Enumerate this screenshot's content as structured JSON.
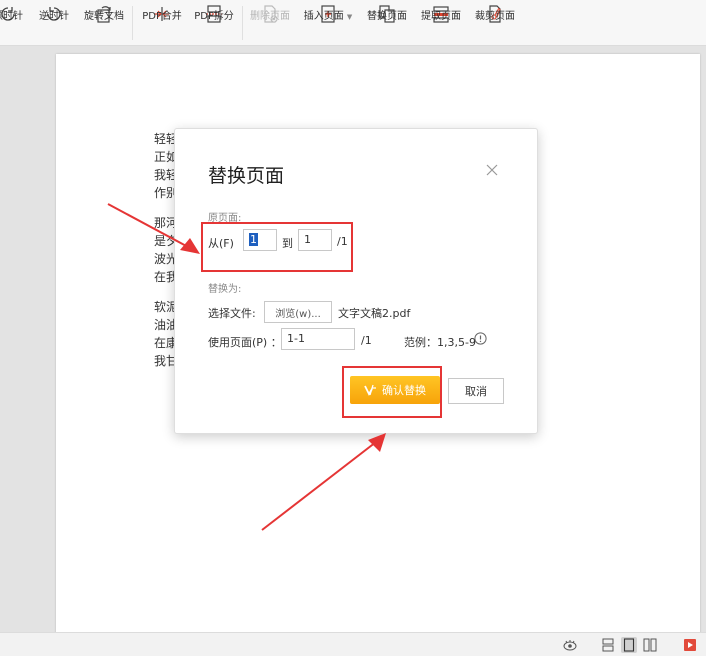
{
  "toolbar": {
    "items": [
      {
        "label": "顺时针",
        "icon": "rotate-clockwise-icon"
      },
      {
        "label": "逆时针",
        "icon": "rotate-counterclockwise-icon"
      },
      {
        "label": "旋转文档",
        "icon": "rotate-document-icon"
      },
      {
        "label": "PDF合并",
        "icon": "pdf-merge-icon"
      },
      {
        "label": "PDF拆分",
        "icon": "pdf-split-icon"
      },
      {
        "label": "删除页面",
        "icon": "delete-page-icon",
        "disabled": true
      },
      {
        "label": "插入页面",
        "icon": "insert-page-icon",
        "dropdown": true
      },
      {
        "label": "替换页面",
        "icon": "replace-page-icon"
      },
      {
        "label": "提取页面",
        "icon": "extract-page-icon"
      },
      {
        "label": "裁剪页面",
        "icon": "crop-page-icon"
      }
    ]
  },
  "document": {
    "lines": [
      "轻轻",
      "正如",
      "我轻",
      "作别",
      "那河",
      "是夕",
      "波光",
      "在我",
      "软泥",
      "油油",
      "在康",
      "我甘"
    ]
  },
  "dialog": {
    "title": "替换页面",
    "original_section": "原页面:",
    "from_label": "从(F)",
    "from_value": "1",
    "to_label": "到",
    "to_value": "1",
    "total_pages": "/1",
    "replace_section": "替换为:",
    "choose_file_label": "选择文件:",
    "browse_label": "浏览(w)...",
    "file_name": "文字文稿2.pdf",
    "use_pages_label": "使用页面(P) ：",
    "use_pages_value": "1-1",
    "use_total": "/1",
    "example": "范例：1,3,5-9",
    "confirm_label": "确认替换",
    "cancel_label": "取消"
  },
  "colors": {
    "accent": "#f7a30a",
    "annotation": "#e53535"
  }
}
